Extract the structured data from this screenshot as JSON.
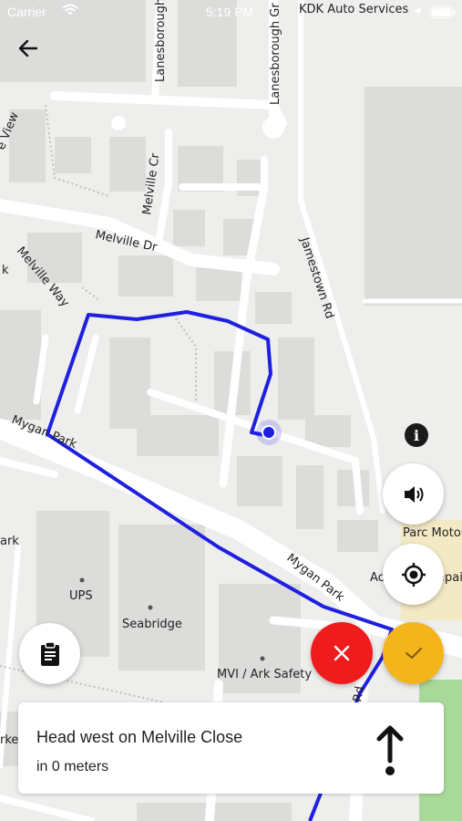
{
  "status_bar": {
    "carrier": "Carrier",
    "time": "5:19 PM"
  },
  "map": {
    "labels": {
      "lanesborough1": "Lanesborough",
      "lanesborough2": "Lanesborough Gr",
      "kdk": "KDK Auto Services",
      "view": "e View",
      "melville_cr": "Melville Cr",
      "melville_dr": "Melville Dr",
      "melville_way": "Melville Way",
      "k_left": "k",
      "jamestown": "Jamestown Rd",
      "mygan_park_left": "Mygan Park",
      "mygan_park_right": "Mygan Park",
      "park": "ark",
      "ups": "UPS",
      "seabridge": "Seabridge",
      "mvi": "MVI / Ark Safety",
      "parc_motor": "Parc Motor",
      "ac": "Ac",
      "repair": "epair",
      "rd": "Rd",
      "rke": "rke"
    }
  },
  "navigation": {
    "instruction": "Head west on Melville Close",
    "distance": "in 0 meters"
  },
  "colors": {
    "route": "#1f1fe0",
    "cancel": "#ee1c1c",
    "confirm": "#f4b51c"
  },
  "icons": {
    "back": "arrow-left-icon",
    "info": "info-icon",
    "sound": "volume-icon",
    "locate": "crosshair-icon",
    "clipboard": "clipboard-icon",
    "cancel": "close-icon",
    "confirm": "check-icon",
    "direction": "arrow-up-icon"
  }
}
